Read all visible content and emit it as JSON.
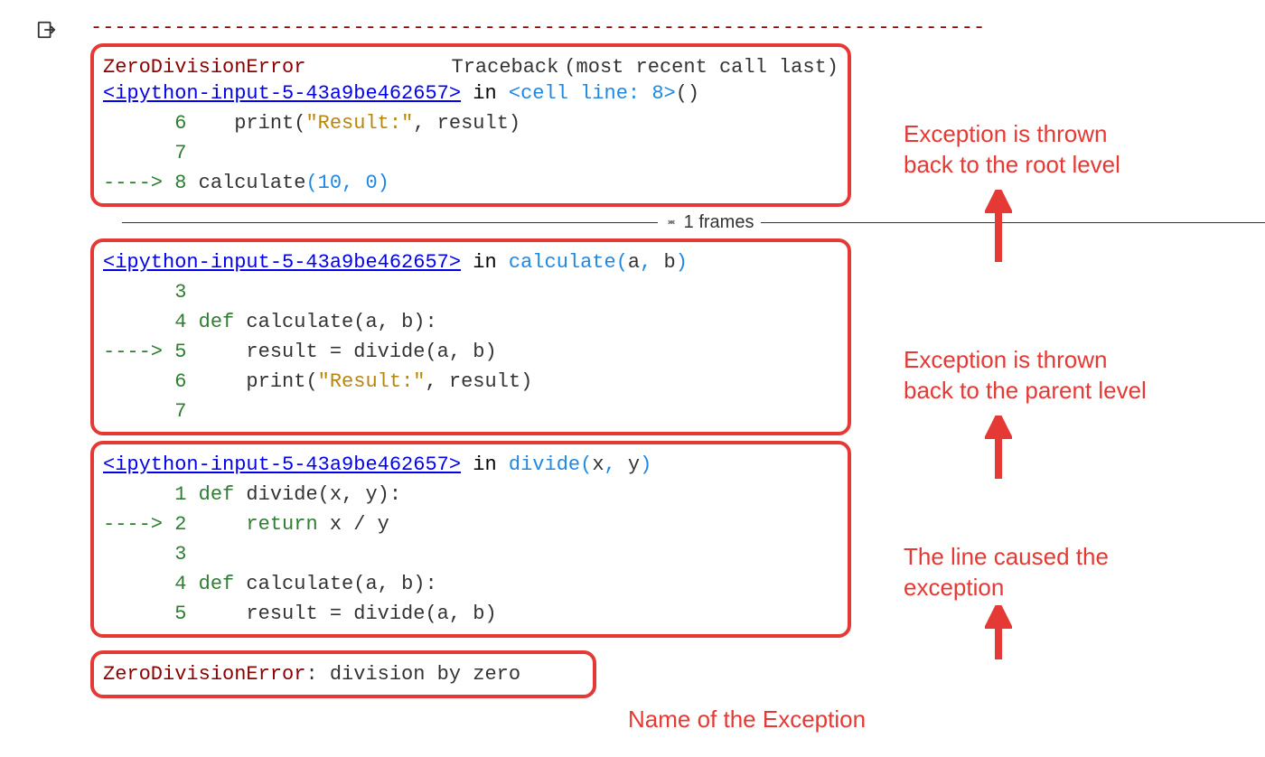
{
  "separator": "---------------------------------------------------------------------------",
  "error_name": "ZeroDivisionError",
  "traceback_label": "Traceback",
  "traceback_note": "(most recent call last)",
  "ipython_ref": "<ipython-input-5-43a9be462657>",
  "kw_in": "in",
  "frames_label": "1 frames",
  "frame1": {
    "location_fn": "<cell line: 8>",
    "location_suffix": "()",
    "lines": [
      {
        "arrow": "      ",
        "num": "6",
        "code_prefix": "    print(",
        "str": "\"Result:\"",
        "code_suffix": ", result)"
      },
      {
        "arrow": "      ",
        "num": "7",
        "code_prefix": "",
        "str": "",
        "code_suffix": ""
      },
      {
        "arrow": "----> ",
        "num": "8",
        "code_prefix": " calculate",
        "paren_open": "(",
        "n1": "10",
        "comma": ", ",
        "n2": "0",
        "paren_close": ")"
      }
    ]
  },
  "frame2": {
    "location_fn": "calculate",
    "location_suffix_open": "(",
    "arg1": "a",
    "arg_sep": ", ",
    "arg2": "b",
    "location_suffix_close": ")",
    "lines": [
      {
        "arrow": "      ",
        "num": "3",
        "text": ""
      },
      {
        "arrow": "      ",
        "num": "4",
        "def": " def",
        "text": " calculate(a, b):"
      },
      {
        "arrow": "----> ",
        "num": "5",
        "text": "     result = divide(a, b)"
      },
      {
        "arrow": "      ",
        "num": "6",
        "prefix": "     print(",
        "str": "\"Result:\"",
        "suffix": ", result)"
      },
      {
        "arrow": "      ",
        "num": "7",
        "text": ""
      }
    ]
  },
  "frame3": {
    "location_fn": "divide",
    "location_suffix_open": "(",
    "arg1": "x",
    "arg_sep": ", ",
    "arg2": "y",
    "location_suffix_close": ")",
    "lines": [
      {
        "arrow": "      ",
        "num": "1",
        "def": " def",
        "text": " divide(x, y):"
      },
      {
        "arrow": "----> ",
        "num": "2",
        "ret": "     return",
        "text": " x / y"
      },
      {
        "arrow": "      ",
        "num": "3",
        "text": ""
      },
      {
        "arrow": "      ",
        "num": "4",
        "def": " def",
        "text": " calculate(a, b):"
      },
      {
        "arrow": "      ",
        "num": "5",
        "text": "     result = divide(a, b)"
      }
    ]
  },
  "final_error": {
    "name": "ZeroDivisionError",
    "sep": ": ",
    "msg": "division by zero"
  },
  "annotations": {
    "a1_l1": "Exception is thrown",
    "a1_l2": "back to the root level",
    "a2_l1": "Exception is thrown",
    "a2_l2": "back to the parent level",
    "a3_l1": "The line caused the",
    "a3_l2": "exception",
    "a4": "Name of the Exception"
  }
}
